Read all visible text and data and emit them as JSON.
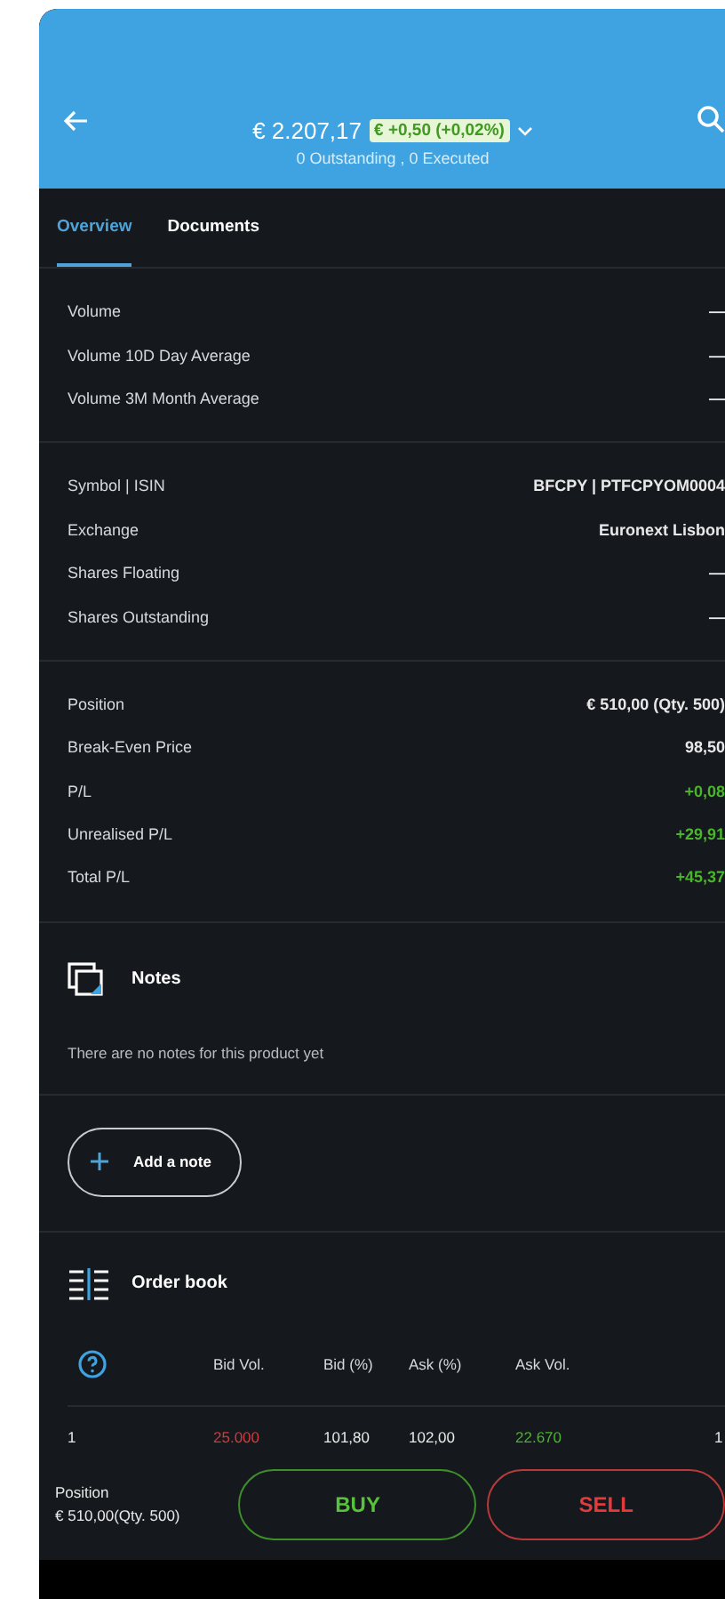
{
  "header": {
    "price": "€ 2.207,17",
    "change": "€ +0,50 (+0,02%)",
    "orders": "0 Outstanding , 0 Executed"
  },
  "tabs": [
    {
      "label": "Overview",
      "selected": true
    },
    {
      "label": "Documents",
      "selected": false
    }
  ],
  "sections": [
    {
      "rows": [
        {
          "label": "Volume",
          "value": "—",
          "kind": "neutral"
        },
        {
          "label": "Volume 10D Day Average",
          "value": "—",
          "kind": "neutral"
        },
        {
          "label": "Volume 3M Month Average",
          "value": "—",
          "kind": "neutral"
        }
      ]
    },
    {
      "rows": [
        {
          "label": "Symbol | ISIN",
          "value": "BFCPY | PTFCPYOM0004",
          "kind": "neutral"
        },
        {
          "label": "Exchange",
          "value": "Euronext Lisbon",
          "kind": "neutral"
        },
        {
          "label": "Shares Floating",
          "value": "—",
          "kind": "neutral"
        },
        {
          "label": "Shares Outstanding",
          "value": "—",
          "kind": "neutral"
        }
      ]
    },
    {
      "rows": [
        {
          "label": "Position",
          "value": "€ 510,00 (Qty. 500)",
          "kind": "neutral"
        },
        {
          "label": "Break-Even Price",
          "value": "98,50",
          "kind": "neutral"
        },
        {
          "label": "P/L",
          "value": "+0,08",
          "kind": "positive"
        },
        {
          "label": "Unrealised P/L",
          "value": "+29,91",
          "kind": "positive"
        },
        {
          "label": "Total P/L",
          "value": "+45,37",
          "kind": "positive"
        }
      ]
    }
  ],
  "notes": {
    "title": "Notes",
    "empty_text": "There are no notes for this product yet",
    "add_button": "Add a note"
  },
  "order_book": {
    "title": "Order book",
    "columns": [
      "",
      "Bid Vol.",
      "Bid (%)",
      "Ask (%)",
      "Ask Vol."
    ],
    "rows": [
      {
        "cells": [
          "1",
          "25.000",
          "101,80",
          "102,00",
          "22.670",
          "1"
        ]
      }
    ]
  },
  "footer": {
    "position_label": "Position",
    "position_value": "€ 510,00(Qty. 500)",
    "buttons": [
      {
        "label": "BUY",
        "kind": "buy"
      },
      {
        "label": "SELL",
        "kind": "sell"
      }
    ]
  }
}
